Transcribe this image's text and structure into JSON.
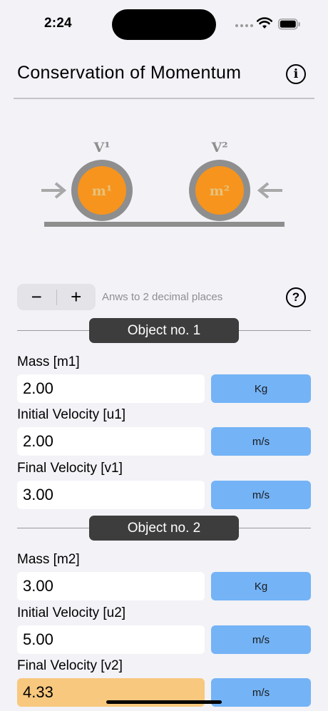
{
  "status": {
    "time": "2:24"
  },
  "header": {
    "title": "Conservation of Momentum"
  },
  "diagram": {
    "v1_label": "V¹",
    "v2_label": "V²",
    "m1_label": "m¹",
    "m2_label": "m²"
  },
  "controls": {
    "minus_label": "−",
    "plus_label": "+",
    "precision_text": "Anws to 2 decimal places",
    "help_label": "?"
  },
  "object1": {
    "title": "Object no. 1",
    "mass": {
      "label": "Mass [m1]",
      "value": "2.00",
      "unit": "Kg"
    },
    "initial_velocity": {
      "label": "Initial Velocity [u1]",
      "value": "2.00",
      "unit": "m/s"
    },
    "final_velocity": {
      "label": "Final Velocity [v1]",
      "value": "3.00",
      "unit": "m/s"
    }
  },
  "object2": {
    "title": "Object no. 2",
    "mass": {
      "label": "Mass [m2]",
      "value": "3.00",
      "unit": "Kg"
    },
    "initial_velocity": {
      "label": "Initial Velocity [u2]",
      "value": "5.00",
      "unit": "m/s"
    },
    "final_velocity": {
      "label": "Final Velocity [v2]",
      "value": "4.33",
      "unit": "m/s"
    }
  },
  "colors": {
    "unit_button": "#74b3f6",
    "result_field": "#f8c87e",
    "ball_fill": "#f7941d",
    "ball_ring": "#8e8e8e",
    "section_pill": "#3d3d3d"
  }
}
